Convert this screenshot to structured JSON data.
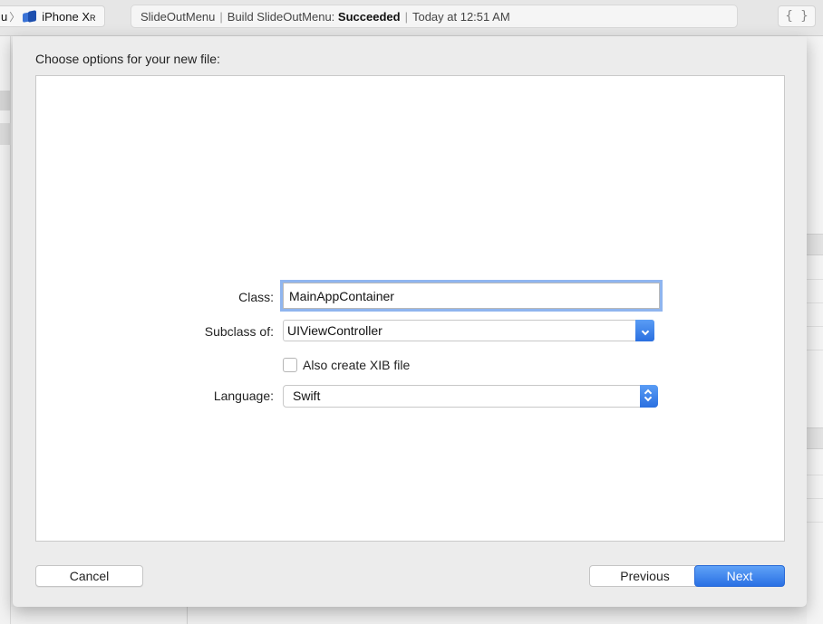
{
  "toolbar": {
    "scheme_cut": "u",
    "device_name": "iPhone X",
    "device_suffix": "R",
    "activity": {
      "project": "SlideOutMenu",
      "build_prefix": "Build SlideOutMenu:",
      "status": "Succeeded",
      "time": "Today at 12:51 AM"
    },
    "braces": "{ }"
  },
  "sheet": {
    "title": "Choose options for your new file:",
    "form": {
      "class_label": "Class:",
      "class_value": "MainAppContainer",
      "subclass_label": "Subclass of:",
      "subclass_value": "UIViewController",
      "xib_label": "Also create XIB file",
      "language_label": "Language:",
      "language_value": "Swift"
    },
    "buttons": {
      "cancel": "Cancel",
      "previous": "Previous",
      "next": "Next"
    }
  },
  "colors": {
    "accent": "#2a70e4",
    "focus_ring": "#8fb5ef",
    "sheet_bg": "#ececec"
  },
  "icons": {
    "device": "xcode-device-icon",
    "chevron": "chevron-right-icon",
    "popup": "chevron-down-icon",
    "stepper": "chevron-up-down-icon"
  }
}
